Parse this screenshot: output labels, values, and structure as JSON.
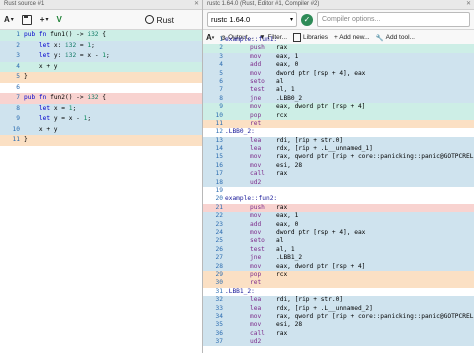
{
  "left": {
    "tab_title": "Rust source #1",
    "tab_close": "✕",
    "font_btn": "A",
    "font_caret": "▾",
    "save_icon": "💾",
    "add_label": "+",
    "add_caret": "▾",
    "vim_label": "V",
    "language": "Rust",
    "lines": [
      {
        "n": "1",
        "bg": "teal",
        "html": "<span class='kw'>pub</span> <span class='kw'>fn</span> fun1() -&gt; <span class='ty'>i32</span> {"
      },
      {
        "n": "2",
        "bg": "blue",
        "html": "    <span class='kw'>let</span> x: <span class='ty'>i32</span> = <span class='num'>1</span>;"
      },
      {
        "n": "3",
        "bg": "blue",
        "html": "    <span class='kw'>let</span> y: <span class='ty'>i32</span> = x - <span class='num'>1</span>;"
      },
      {
        "n": "4",
        "bg": "teal",
        "html": "    x + y"
      },
      {
        "n": "5",
        "bg": "orange",
        "html": "}"
      },
      {
        "n": "6",
        "bg": "white",
        "html": ""
      },
      {
        "n": "7",
        "bg": "red",
        "html": "<span class='kw'>pub</span> <span class='kw'>fn</span> fun2() -&gt; <span class='ty'>i32</span> {"
      },
      {
        "n": "8",
        "bg": "blue",
        "html": "    <span class='kw'>let</span> x = <span class='num'>1</span>;"
      },
      {
        "n": "9",
        "bg": "blue",
        "html": "    <span class='kw'>let</span> y = x - <span class='num'>1</span>;"
      },
      {
        "n": "10",
        "bg": "blue",
        "html": "    x + y"
      },
      {
        "n": "11",
        "bg": "orange",
        "html": "}"
      }
    ]
  },
  "right": {
    "tab_title": "rustc 1.64.0 (Rust, Editor #1, Compiler #2)",
    "tab_close": "✕",
    "compiler": "rustc 1.64.0",
    "compiler_caret": "▾",
    "check": "✓",
    "options_placeholder": "Compiler options...",
    "toolbar": {
      "font": "A",
      "font_caret": "▾",
      "output": "Output...",
      "filter": "Filter...",
      "libraries": "Libraries",
      "add_new": "+ Add new...",
      "add_tool": "Add tool..."
    },
    "lines": [
      {
        "n": "1",
        "bg": "white",
        "label": "example::fun1:",
        "op": "",
        "args": ""
      },
      {
        "n": "2",
        "bg": "teal",
        "label": "",
        "op": "push",
        "args": "rax"
      },
      {
        "n": "3",
        "bg": "blue",
        "label": "",
        "op": "mov",
        "args": "eax, 1"
      },
      {
        "n": "4",
        "bg": "blue",
        "label": "",
        "op": "add",
        "args": "eax, 0"
      },
      {
        "n": "5",
        "bg": "blue",
        "label": "",
        "op": "mov",
        "args": "dword ptr [rsp + 4], eax"
      },
      {
        "n": "6",
        "bg": "blue",
        "label": "",
        "op": "seto",
        "args": "al"
      },
      {
        "n": "7",
        "bg": "blue",
        "label": "",
        "op": "test",
        "args": "al, 1"
      },
      {
        "n": "8",
        "bg": "blue",
        "label": "",
        "op": "jne",
        "args": ".LBB0_2"
      },
      {
        "n": "9",
        "bg": "teal",
        "label": "",
        "op": "mov",
        "args": "eax, dword ptr [rsp + 4]"
      },
      {
        "n": "10",
        "bg": "teal",
        "label": "",
        "op": "pop",
        "args": "rcx"
      },
      {
        "n": "11",
        "bg": "orange",
        "label": "",
        "op": "ret",
        "args": ""
      },
      {
        "n": "12",
        "bg": "white",
        "label": ".LBB0_2:",
        "op": "",
        "args": ""
      },
      {
        "n": "13",
        "bg": "blue",
        "label": "",
        "op": "lea",
        "args": "rdi, [rip + str.0]"
      },
      {
        "n": "14",
        "bg": "blue",
        "label": "",
        "op": "lea",
        "args": "rdx, [rip + .L__unnamed_1]"
      },
      {
        "n": "15",
        "bg": "blue",
        "label": "",
        "op": "mov",
        "args": "rax, qword ptr [rip + core::panicking::panic@GOTPCREL]"
      },
      {
        "n": "16",
        "bg": "blue",
        "label": "",
        "op": "mov",
        "args": "esi, 28"
      },
      {
        "n": "17",
        "bg": "blue",
        "label": "",
        "op": "call",
        "args": "rax"
      },
      {
        "n": "18",
        "bg": "blue",
        "label": "",
        "op": "ud2",
        "args": ""
      },
      {
        "n": "19",
        "bg": "white",
        "label": "",
        "op": "",
        "args": ""
      },
      {
        "n": "20",
        "bg": "white",
        "label": "example::fun2:",
        "op": "",
        "args": ""
      },
      {
        "n": "21",
        "bg": "red",
        "label": "",
        "op": "push",
        "args": "rax"
      },
      {
        "n": "22",
        "bg": "blue",
        "label": "",
        "op": "mov",
        "args": "eax, 1"
      },
      {
        "n": "23",
        "bg": "blue",
        "label": "",
        "op": "add",
        "args": "eax, 0"
      },
      {
        "n": "24",
        "bg": "blue",
        "label": "",
        "op": "mov",
        "args": "dword ptr [rsp + 4], eax"
      },
      {
        "n": "25",
        "bg": "blue",
        "label": "",
        "op": "seto",
        "args": "al"
      },
      {
        "n": "26",
        "bg": "blue",
        "label": "",
        "op": "test",
        "args": "al, 1"
      },
      {
        "n": "27",
        "bg": "blue",
        "label": "",
        "op": "jne",
        "args": ".LBB1_2"
      },
      {
        "n": "28",
        "bg": "blue",
        "label": "",
        "op": "mov",
        "args": "eax, dword ptr [rsp + 4]"
      },
      {
        "n": "29",
        "bg": "orange",
        "label": "",
        "op": "pop",
        "args": "rcx"
      },
      {
        "n": "30",
        "bg": "orange",
        "label": "",
        "op": "ret",
        "args": ""
      },
      {
        "n": "31",
        "bg": "white",
        "label": ".LBB1_2:",
        "op": "",
        "args": ""
      },
      {
        "n": "32",
        "bg": "blue",
        "label": "",
        "op": "lea",
        "args": "rdi, [rip + str.0]"
      },
      {
        "n": "33",
        "bg": "blue",
        "label": "",
        "op": "lea",
        "args": "rdx, [rip + .L__unnamed_2]"
      },
      {
        "n": "34",
        "bg": "blue",
        "label": "",
        "op": "mov",
        "args": "rax, qword ptr [rip + core::panicking::panic@GOTPCREL]"
      },
      {
        "n": "35",
        "bg": "blue",
        "label": "",
        "op": "mov",
        "args": "esi, 28"
      },
      {
        "n": "36",
        "bg": "blue",
        "label": "",
        "op": "call",
        "args": "rax"
      },
      {
        "n": "37",
        "bg": "blue",
        "label": "",
        "op": "ud2",
        "args": ""
      }
    ]
  }
}
